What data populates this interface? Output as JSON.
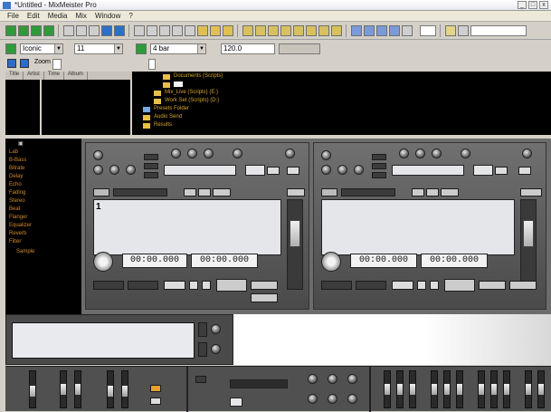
{
  "window": {
    "title": "*Untitled - MixMeister Pro",
    "minimize": "_",
    "maximize": "□",
    "close": "x"
  },
  "menu": [
    "File",
    "Edit",
    "Media",
    "Mix",
    "Window",
    "?"
  ],
  "toolbar2": {
    "style_value": "Iconic",
    "size_value": "11",
    "key_value": "4 bar",
    "tempo_value": "120.0"
  },
  "leftbar": {
    "label": "Zoom"
  },
  "list_headers": [
    "Title",
    "Artist",
    "Time",
    "Album"
  ],
  "tree": {
    "items": [
      "Documents (Scripts)",
      "",
      "Mix_Live (Scripts) (E:)",
      "Work Set (Scripts) (D:)",
      "Presets Folder",
      "Audio Send",
      "Results"
    ]
  },
  "plugins": [
    "Lab",
    "B-Bass",
    "Bitrate",
    "Delay",
    "Echo",
    "Fading",
    "Stereo",
    "Beat",
    "Flanger",
    "Equalizer",
    "Reverb",
    "Filter",
    "Sample"
  ],
  "deck_left": {
    "track_number": "1",
    "time_elapsed": "00:00.000",
    "time_remaining": "00:00.000"
  },
  "deck_right": {
    "time_elapsed": "00:00.000",
    "time_remaining": "00:00.000"
  },
  "colors": {
    "titlebar": "#e8e8f0",
    "toolbar": "#d4d0c8",
    "pane_black": "#000000",
    "tree_text": "#d7a72c",
    "deck_body": "#5a5a5a"
  }
}
